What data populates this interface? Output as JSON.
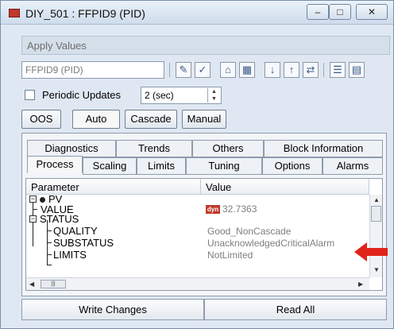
{
  "window": {
    "title": "DIY_501 : FFPID9 (PID)",
    "minimize": "–",
    "maximize": "□",
    "close": "✕"
  },
  "menu": {
    "apply_values": "Apply Values"
  },
  "toolbar": {
    "block_name": "FFPID9 (PID)",
    "icons": [
      "edit-icon",
      "edit-check-icon",
      "tree-icon",
      "grid-icon",
      "download-icon",
      "upload-icon",
      "compare-icon",
      "list-icon",
      "details-icon"
    ]
  },
  "options": {
    "periodic_updates_label": "Periodic Updates",
    "periodic_updates_checked": false,
    "interval_value": "2 (sec)"
  },
  "modes": {
    "oos": "OOS",
    "auto": "Auto",
    "cascade": "Cascade",
    "manual": "Manual",
    "selected": "Auto"
  },
  "tabs": {
    "row1": [
      "Diagnostics",
      "Trends",
      "Others",
      "Block Information"
    ],
    "row2": [
      "Process",
      "Scaling",
      "Limits",
      "Tuning",
      "Options",
      "Alarms"
    ],
    "active": "Process"
  },
  "grid": {
    "col_parameter": "Parameter",
    "col_value": "Value",
    "rows": [
      {
        "name": "PV",
        "value": ""
      },
      {
        "name": "VALUE",
        "value": "32.7363",
        "badge": "dyn"
      },
      {
        "name": "STATUS",
        "value": ""
      },
      {
        "name": "QUALITY",
        "value": "Good_NonCascade"
      },
      {
        "name": "SUBSTATUS",
        "value": "UnacknowledgedCriticalAlarm"
      },
      {
        "name": "LIMITS",
        "value": "NotLimited"
      }
    ]
  },
  "buttons": {
    "write_changes": "Write Changes",
    "read_all": "Read All"
  },
  "colors": {
    "accent_red": "#e0231b",
    "badge_red": "#c0392b"
  }
}
